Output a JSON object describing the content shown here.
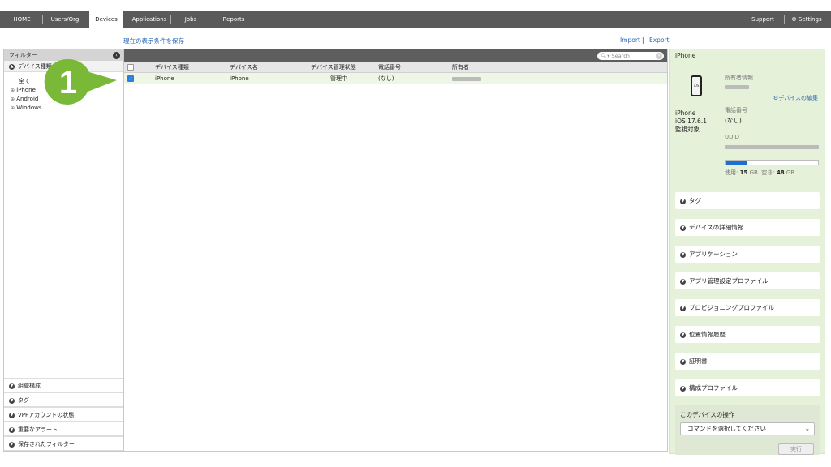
{
  "nav": {
    "items": [
      "HOME",
      "Users/Org",
      "Devices",
      "Applications",
      "Jobs",
      "Reports"
    ],
    "support": "Support",
    "settings": "Settings"
  },
  "toolbar": {
    "save_view": "現在の表示条件を保存",
    "import": "Import",
    "separator": "|",
    "export": "Export"
  },
  "filter": {
    "header": "フィルター",
    "device_type_section": "デバイス種類",
    "items": [
      "全て",
      "iPhone",
      "Android",
      "Windows"
    ],
    "bottom_sections": [
      "組織構成",
      "タグ",
      "VPPアカウントの状態",
      "重要なアラート",
      "保存されたフィルター"
    ]
  },
  "search": {
    "placeholder": "Search"
  },
  "table": {
    "headers": [
      "デバイス種類",
      "デバイス名",
      "デバイス管理状態",
      "電話番号",
      "所有者"
    ],
    "rows": [
      {
        "type": "iPhone",
        "name": "iPhone",
        "status": "管理中",
        "phone": "(なし)",
        "checked": true
      }
    ]
  },
  "detail": {
    "title": "iPhone",
    "device_model": "iPhone",
    "os": "iOS 17.6.1",
    "supervised": "監視対象",
    "owner_label": "所有者情報",
    "edit_link": "デバイスの編集",
    "phone_label": "電話番号",
    "phone_value": "(なし)",
    "udid_label": "UDID",
    "used_label": "使用:",
    "used_value": "15",
    "free_label": "空き:",
    "free_value": "48",
    "unit": "GB",
    "storage_used_fraction": 0.24,
    "sections": [
      "タグ",
      "デバイスの詳細情報",
      "アプリケーション",
      "アプリ管理設定プロファイル",
      "プロビジョニングプロファイル",
      "位置情報履歴",
      "証明書",
      "構成プロファイル"
    ],
    "actions_title": "このデバイスの操作",
    "command_select": "コマンドを選択してください",
    "execute": "実行"
  },
  "callout": {
    "number": "1"
  },
  "colors": {
    "accent": "#2a6ab8",
    "panel_green": "#e6f1da",
    "callout": "#7ab837",
    "topbar": "#5a5a5a"
  }
}
